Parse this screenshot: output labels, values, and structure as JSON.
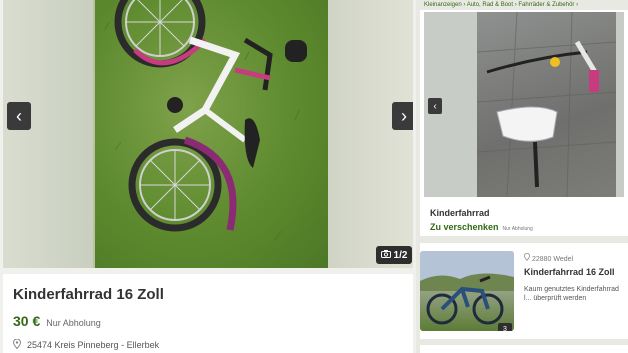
{
  "main": {
    "gallery": {
      "prev_label": "‹",
      "next_label": "›",
      "counter_icon": "camera-icon",
      "counter_text": "1/2"
    },
    "title": "Kinderfahrrad 16 Zoll",
    "price": "30 €",
    "pickup": "Nur Abholung",
    "location": "25474 Kreis Pinneberg - Ellerbek"
  },
  "right": {
    "breadcrumbs": "Kleinanzeigen › Auto, Rad & Boot › Fahrräder & Zubehör ›",
    "card": {
      "prev_label": "‹",
      "title": "Kinderfahrrad",
      "price": "Zu verschenken",
      "pickup": "Nur Abholung"
    },
    "card2": {
      "location": "22880 Wedel",
      "title": "Kinderfahrrad 16 Zoll",
      "description": "Kaum genutztes Kinderfahrrad l... überprüft werden",
      "image_count": "3"
    }
  },
  "colors": {
    "price_green": "#326916",
    "nav_dark": "#3a3a3a"
  }
}
